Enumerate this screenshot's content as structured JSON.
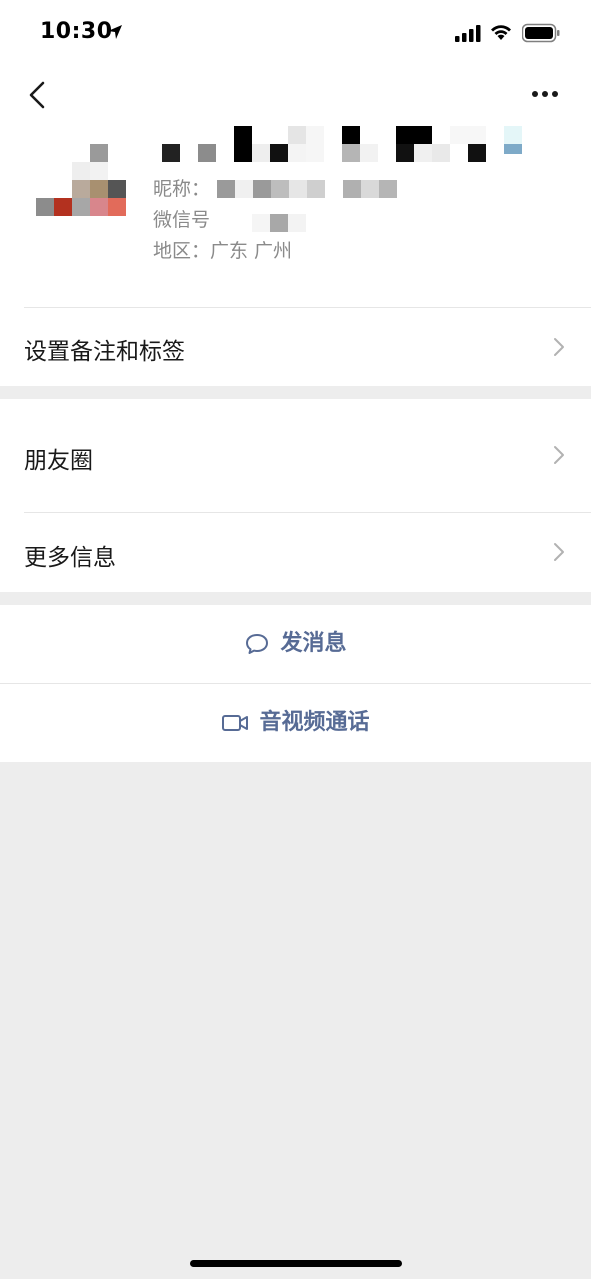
{
  "status_bar": {
    "time": "10:30"
  },
  "profile": {
    "nickname_label": "昵称：",
    "wechat_id_label": "微信号",
    "region_label": "地区：",
    "region_value": "广东 广州"
  },
  "menu": {
    "set_remark": "设置备注和标签",
    "moments": "朋友圈",
    "more_info": "更多信息"
  },
  "actions": {
    "send_message": "发消息",
    "video_call": "音视频通话"
  },
  "colors": {
    "accent": "#576b95",
    "background": "#ededed",
    "text": "#191919",
    "secondary_text": "#8a8a8a"
  }
}
